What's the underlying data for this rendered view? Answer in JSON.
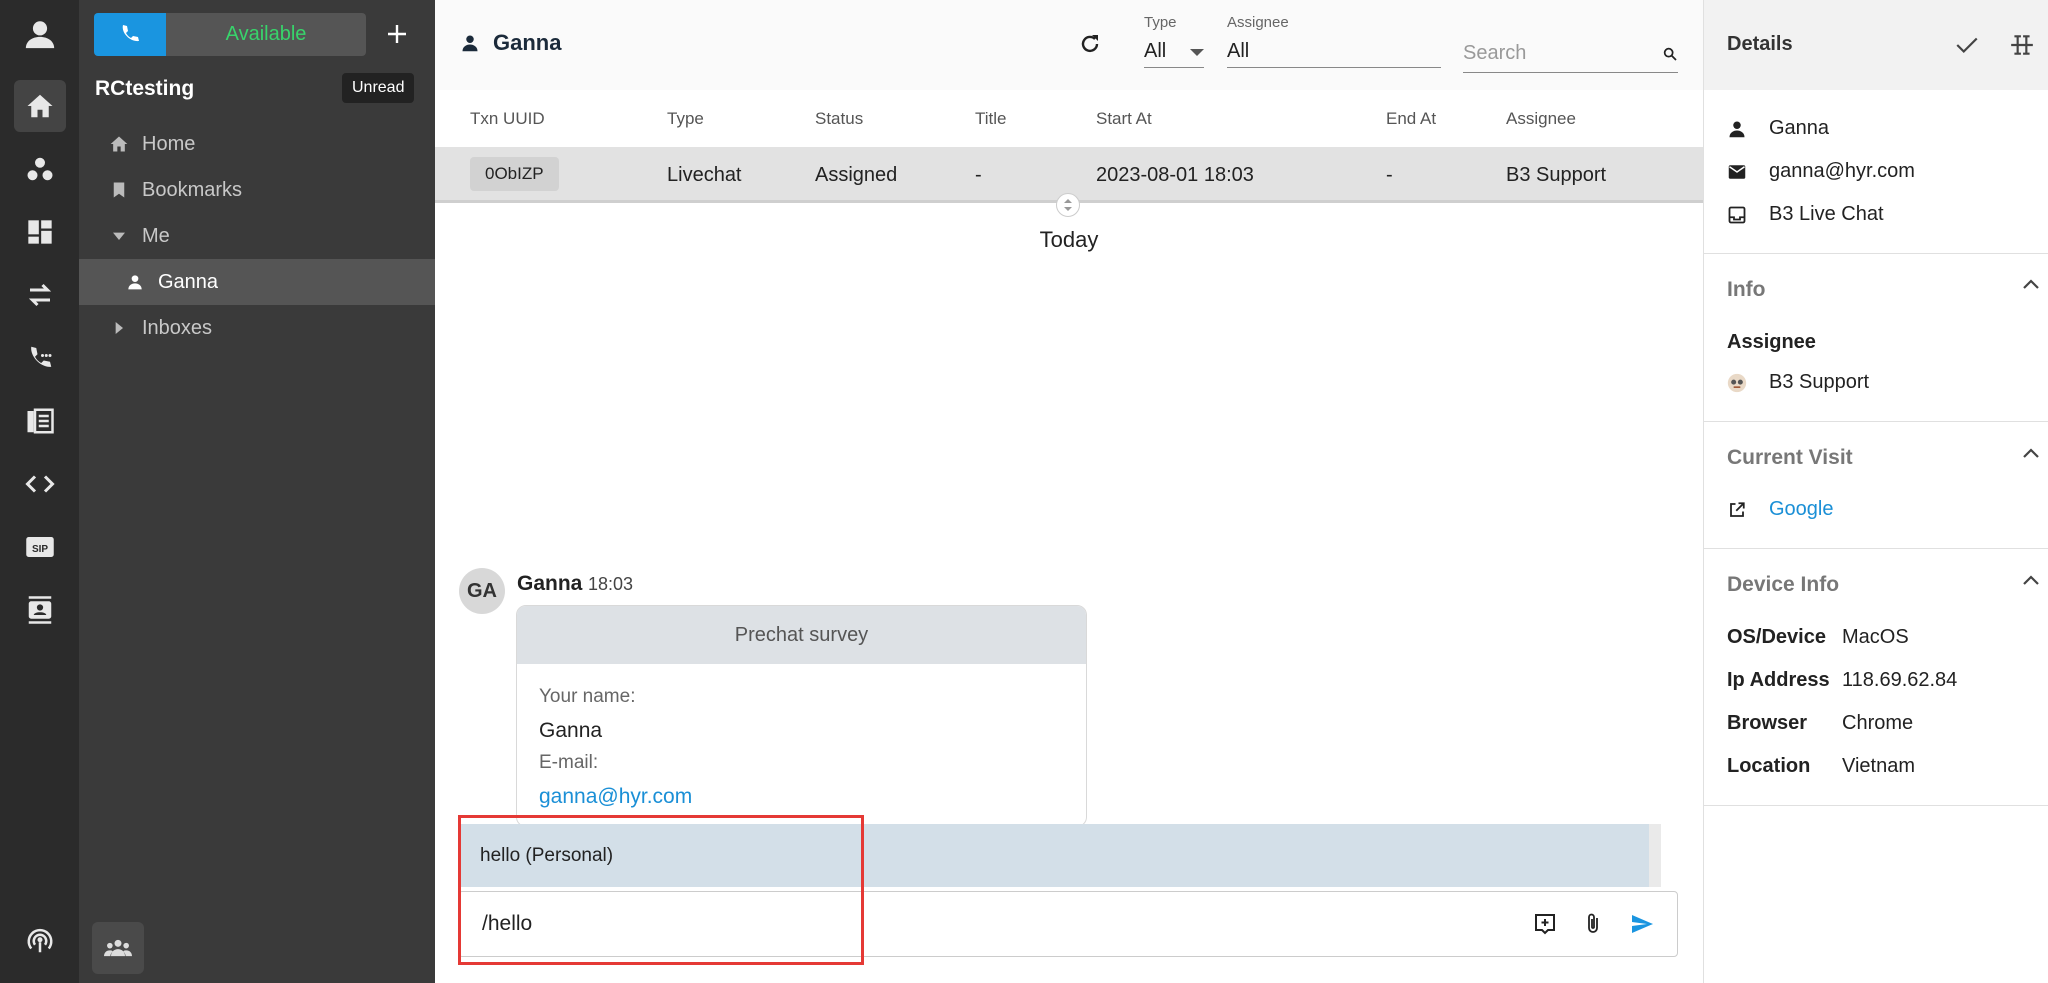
{
  "nav": {
    "status_label": "Available",
    "org_name": "RCtesting",
    "unread_tooltip": "Unread",
    "items": [
      {
        "label": "Home"
      },
      {
        "label": "Bookmarks"
      },
      {
        "label": "Me"
      },
      {
        "label": "Ganna"
      },
      {
        "label": "Inboxes"
      }
    ]
  },
  "header": {
    "contact_name": "Ganna",
    "type_label": "Type",
    "type_value": "All",
    "assignee_label": "Assignee",
    "assignee_value": "All",
    "search_placeholder": "Search"
  },
  "table": {
    "columns": [
      "Txn UUID",
      "Type",
      "Status",
      "Title",
      "Start At",
      "End At",
      "Assignee"
    ],
    "row": {
      "uuid": "0ObIZP",
      "type": "Livechat",
      "status": "Assigned",
      "title": "-",
      "start_at": "2023-08-01 18:03",
      "end_at": "-",
      "assignee": "B3 Support"
    }
  },
  "chat": {
    "date_separator": "Today",
    "avatar_initials": "GA",
    "sender": "Ganna",
    "time": "18:03",
    "card_title": "Prechat survey",
    "name_label": "Your name:",
    "name_value": "Ganna",
    "email_label": "E-mail:",
    "email_value": "ganna@hyr.com",
    "suggestion": "hello (Personal)",
    "composer_value": "/hello"
  },
  "details": {
    "title": "Details",
    "name": "Ganna",
    "email": "ganna@hyr.com",
    "inbox": "B3 Live Chat",
    "info_title": "Info",
    "assignee_label": "Assignee",
    "assignee_value": "B3 Support",
    "visit_title": "Current Visit",
    "visit_link": "Google",
    "device_title": "Device Info",
    "device": [
      {
        "k": "OS/Device",
        "v": "MacOS"
      },
      {
        "k": "Ip Address",
        "v": "118.69.62.84"
      },
      {
        "k": "Browser",
        "v": "Chrome"
      },
      {
        "k": "Location",
        "v": "Vietnam"
      }
    ]
  },
  "colors": {
    "accent": "#1a95e0",
    "available": "#38d46b",
    "highlight": "#e53935"
  }
}
